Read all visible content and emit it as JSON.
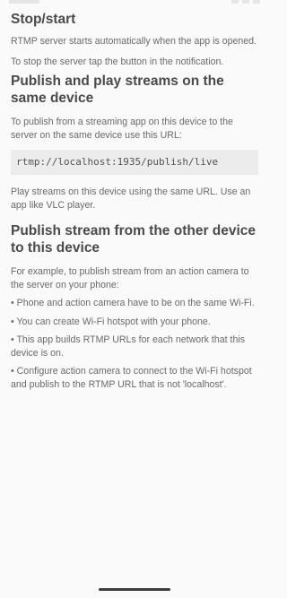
{
  "sections": [
    {
      "title": "Stop/start",
      "paragraphs": [
        "RTMP server starts automatically when the app is opened.",
        "To stop the server tap the button in the notification."
      ]
    },
    {
      "title": "Publish and play streams on the same device",
      "intro": "To publish from a streaming app on this device to the server on the same device use this URL:",
      "url": "rtmp://localhost:1935/publish/live",
      "outro": "Play streams on this device using the same URL. Use an app like VLC player."
    },
    {
      "title": "Publish stream from the other device to this device",
      "intro": "For example, to publish stream from an action camera to the server on your phone:",
      "bullets": [
        "• Phone and action camera have to be on the same Wi-Fi.",
        "• You can create Wi-Fi hotspot with your phone.",
        "• This app builds RTMP URLs for each network that this device is on.",
        "• Configure action camera to connect to the Wi-Fi hotspot and publish to the RTMP URL that is not 'localhost'."
      ]
    }
  ]
}
